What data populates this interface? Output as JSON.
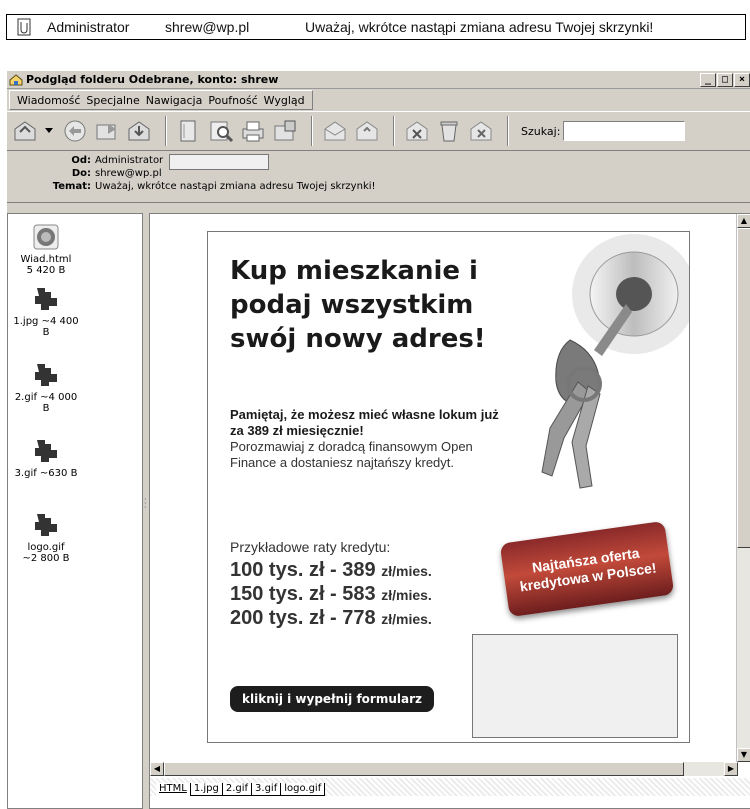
{
  "email_row": {
    "sender": "Administrator",
    "recipient": "shrew@wp.pl",
    "subject": "Uważaj, wkrótce nastąpi zmiana adresu Twojej skrzynki!"
  },
  "window": {
    "title": "Podgląd folderu Odebrane, konto: shrew",
    "buttons": [
      "_",
      "□",
      "×"
    ]
  },
  "menu": [
    "Wiadomość",
    "Specjalne",
    "Nawigacja",
    "Poufność",
    "Wygląd"
  ],
  "toolbar": {
    "search_label": "Szukaj:",
    "search_value": ""
  },
  "headers": {
    "from_label": "Od:",
    "from_value": "Administrator",
    "to_label": "Do:",
    "to_value": "shrew@wp.pl",
    "subject_label": "Temat:",
    "subject_value": "Uważaj, wkrótce nastąpi zmiana adresu Twojej skrzynki!"
  },
  "attachments": [
    {
      "name": "Wiad.html",
      "size": "5 420 B",
      "icon": "html-file-icon"
    },
    {
      "name": "1.jpg ~4 400",
      "size": "B",
      "icon": "image-file-icon"
    },
    {
      "name": "2.gif ~4 000",
      "size": "B",
      "icon": "image-file-icon"
    },
    {
      "name": "3.gif ~630 B",
      "size": "",
      "icon": "image-file-icon"
    },
    {
      "name": "logo.gif",
      "size": "~2 800 B",
      "icon": "image-file-icon"
    }
  ],
  "tabs": [
    "HTML",
    "1.jpg",
    "2.gif",
    "3.gif",
    "logo.gif"
  ],
  "ad": {
    "headline": "Kup mieszkanie i podaj wszystkim swój nowy adres!",
    "bold_text": "Pamiętaj, że możesz mieć własne lokum już za 389 zł miesięcznie!",
    "text": "Porozmawiaj z doradcą finansowym Open Finance a dostaniesz najtańszy kredyt.",
    "rates_label": "Przykładowe raty kredytu:",
    "rates": [
      {
        "amount": "100 tys. zł - 389",
        "unit": "zł/mies."
      },
      {
        "amount": "150 tys. zł - 583",
        "unit": "zł/mies."
      },
      {
        "amount": "200 tys. zł - 778",
        "unit": "zł/mies."
      }
    ],
    "badge": "Najtańsza oferta kredytowa w Polsce!",
    "cta": "kliknij i wypełnij formularz"
  }
}
